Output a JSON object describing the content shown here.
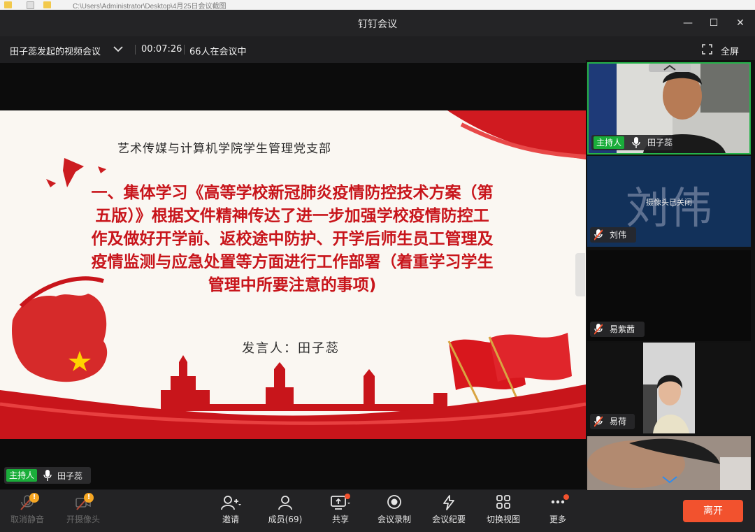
{
  "os_strip": {
    "path": "C:\\Users\\Administrator\\Desktop\\4月25日会议截图"
  },
  "window": {
    "title": "钉钉会议",
    "minimize": "—",
    "maximize": "☐",
    "close": "✕"
  },
  "infobar": {
    "topic": "田子蕊发起的视频会议",
    "timer": "00:07:26",
    "participants_text": "66人在会议中",
    "fullscreen_label": "全屏"
  },
  "slide": {
    "dept": "艺术传媒与计算机学院学生管理党支部",
    "headline": "一、集体学习《高等学校新冠肺炎疫情防控技术方案（第五版）》根据文件精神传达了进一步加强学校疫情防控工作及做好开学前、返校途中防护、开学后师生员工管理及疫情监测与应急处置等方面进行工作部署（着重学习学生管理中所要注意的事项)",
    "speaker": "发言人：田子蕊"
  },
  "main_speaker": {
    "host_badge": "主持人",
    "name": "田子蕊"
  },
  "participants": [
    {
      "name": "田子蕊",
      "host_badge": "主持人",
      "muted": false
    },
    {
      "name": "刘伟",
      "big_name": "刘伟",
      "camera_off": "摄像头已关闭",
      "muted": true
    },
    {
      "name": "易紫茜",
      "muted": true
    },
    {
      "name": "易荷",
      "muted": true
    }
  ],
  "toolbar": {
    "mute": "取消静音",
    "camera": "开摄像头",
    "invite": "邀请",
    "members": "成员(69)",
    "share": "共享",
    "record": "会议录制",
    "minutes": "会议纪要",
    "view": "切换视图",
    "more": "更多",
    "leave": "离开",
    "warn_mark": "!"
  },
  "colors": {
    "accent_red": "#c8151b",
    "host_green": "#1aad3a",
    "leave_orange": "#f2522e",
    "active_border": "#25b34a"
  }
}
